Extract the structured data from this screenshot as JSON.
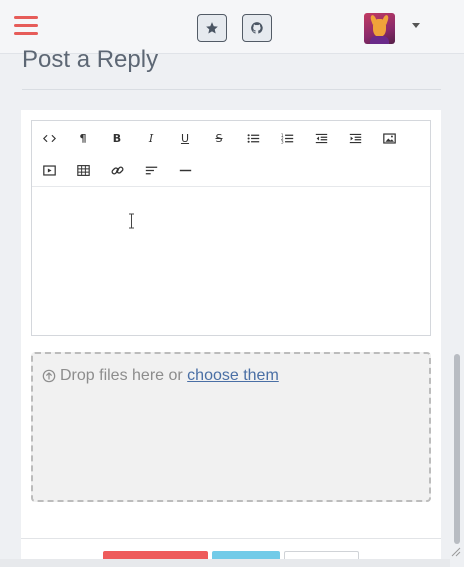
{
  "navbar": {
    "menu_icon": "hamburger-icon",
    "star_icon": "star-icon",
    "github_icon": "github-icon",
    "user_menu_icon": "caret-down-icon"
  },
  "reply": {
    "heading": "Post a Reply"
  },
  "editor": {
    "toolbar_row1": [
      {
        "name": "code-view-icon",
        "glyph": "<>"
      },
      {
        "name": "paragraph-icon",
        "glyph": "¶"
      },
      {
        "name": "bold-icon",
        "glyph": "B"
      },
      {
        "name": "italic-icon",
        "glyph": "I"
      },
      {
        "name": "underline-icon",
        "glyph": "U"
      },
      {
        "name": "strikethrough-icon",
        "glyph": "S"
      },
      {
        "name": "unordered-list-icon",
        "glyph": ""
      },
      {
        "name": "ordered-list-icon",
        "glyph": ""
      },
      {
        "name": "outdent-icon",
        "glyph": ""
      },
      {
        "name": "indent-icon",
        "glyph": ""
      },
      {
        "name": "image-icon",
        "glyph": ""
      }
    ],
    "toolbar_row2": [
      {
        "name": "video-icon",
        "glyph": ""
      },
      {
        "name": "table-icon",
        "glyph": ""
      },
      {
        "name": "link-icon",
        "glyph": ""
      },
      {
        "name": "align-icon",
        "glyph": ""
      },
      {
        "name": "horizontal-rule-icon",
        "glyph": ""
      }
    ],
    "content": ""
  },
  "dropzone": {
    "icon": "upload-arrow-icon",
    "text": "Drop files here or",
    "link": "choose them"
  },
  "colors": {
    "accent_red": "#ee5b5b",
    "accent_cyan": "#72cbe8",
    "heading": "#5d6774",
    "link": "#4a6fa5"
  }
}
